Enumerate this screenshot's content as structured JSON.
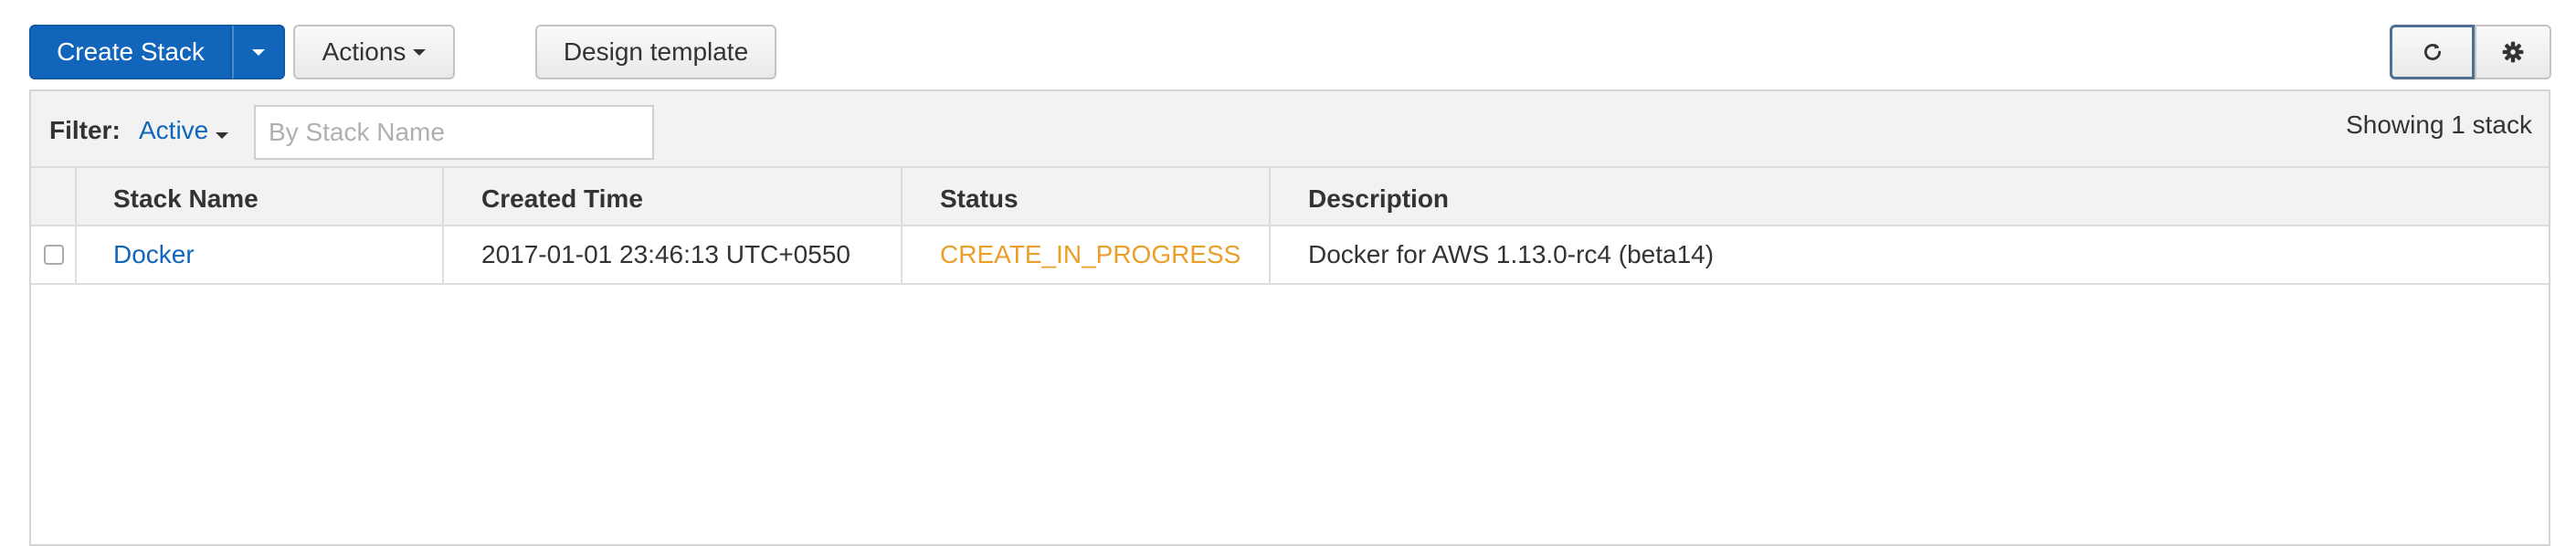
{
  "toolbar": {
    "create_stack_label": "Create Stack",
    "actions_label": "Actions",
    "design_template_label": "Design template"
  },
  "filter": {
    "label": "Filter:",
    "active_value": "Active",
    "search_placeholder": "By Stack Name",
    "showing_text": "Showing 1 stack"
  },
  "table": {
    "columns": [
      "Stack Name",
      "Created Time",
      "Status",
      "Description"
    ],
    "rows": [
      {
        "stack_name": "Docker",
        "created_time": "2017-01-01 23:46:13 UTC+0550",
        "status": "CREATE_IN_PROGRESS",
        "description": "Docker for AWS 1.13.0-rc4 (beta14)"
      }
    ]
  },
  "colors": {
    "primary": "#1166bb",
    "status_in_progress": "#eb9f28"
  }
}
